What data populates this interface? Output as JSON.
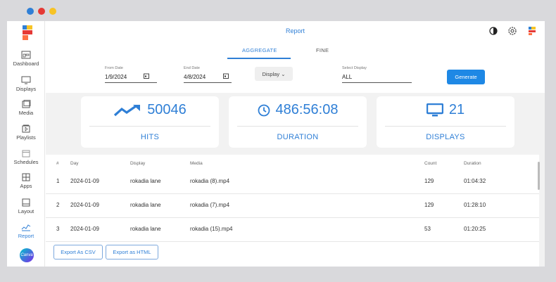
{
  "colors": {
    "close": "#2f7fd6",
    "min": "#e53935",
    "max": "#f7c325",
    "accent": "#2f7fd6"
  },
  "sidebar": {
    "items": [
      {
        "label": "Dashboard",
        "icon": "dashboard-icon"
      },
      {
        "label": "Displays",
        "icon": "monitor-icon"
      },
      {
        "label": "Media",
        "icon": "media-icon"
      },
      {
        "label": "Playlists",
        "icon": "playlist-icon"
      },
      {
        "label": "Schedules",
        "icon": "calendar-icon"
      },
      {
        "label": "Apps",
        "icon": "apps-icon"
      },
      {
        "label": "Layout",
        "icon": "layout-icon"
      },
      {
        "label": "Report",
        "icon": "chart-icon"
      }
    ],
    "canva": "Canva"
  },
  "header": {
    "title": "Report",
    "tabs": [
      {
        "label": "AGGREGATE"
      },
      {
        "label": "FINE"
      }
    ]
  },
  "filters": {
    "from_label": "From Date",
    "from_value": "1/9/2024",
    "end_label": "End Date",
    "end_value": "4/8/2024",
    "display_btn": "Display ⌄",
    "select_label": "Select Display",
    "select_value": "ALL",
    "generate": "Generate"
  },
  "cards": [
    {
      "value": "50046",
      "label": "HITS",
      "icon": "trending-up-icon"
    },
    {
      "value": "486:56:08",
      "label": "DURATION",
      "icon": "clock-icon"
    },
    {
      "value": "21",
      "label": "DISPLAYS",
      "icon": "monitor-icon"
    }
  ],
  "table": {
    "headers": [
      "#",
      "Day",
      "Display",
      "Media",
      "Count",
      "Duration"
    ],
    "rows": [
      [
        "1",
        "2024-01-09",
        "rokadia lane",
        "rokadia (8).mp4",
        "129",
        "01:04:32"
      ],
      [
        "2",
        "2024-01-09",
        "rokadia lane",
        "rokadia (7).mp4",
        "129",
        "01:28:10"
      ],
      [
        "3",
        "2024-01-09",
        "rokadia lane",
        "rokadia (15).mp4",
        "53",
        "01:20:25"
      ]
    ]
  },
  "export": {
    "csv": "Export As CSV",
    "html": "Export as HTML"
  }
}
